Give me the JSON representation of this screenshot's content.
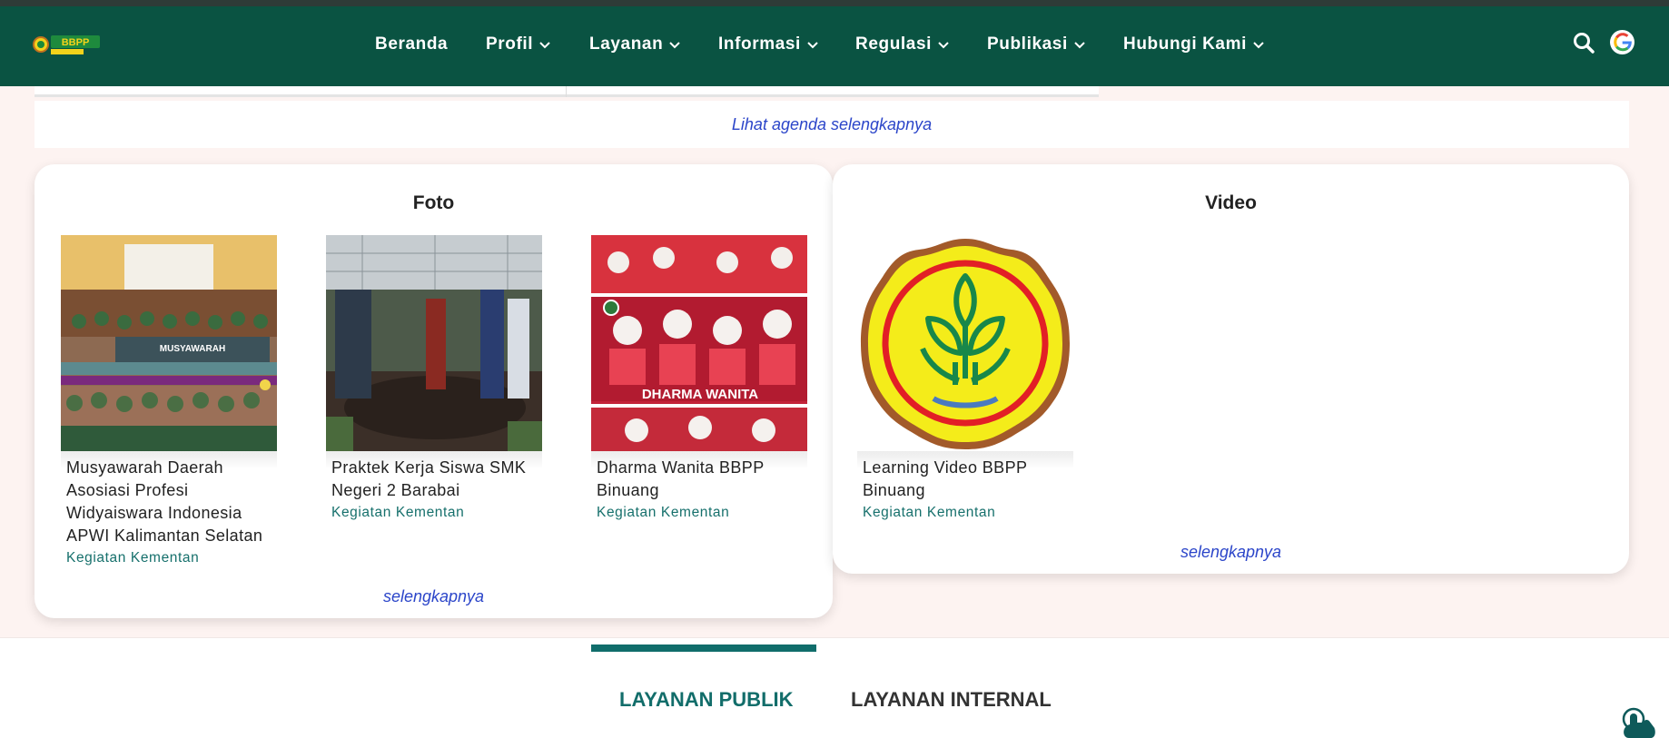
{
  "navbar": {
    "logo_icon": "bbpp-binuang-logo",
    "items": [
      {
        "label": "Beranda",
        "dropdown": false
      },
      {
        "label": "Profil",
        "dropdown": true
      },
      {
        "label": "Layanan",
        "dropdown": true
      },
      {
        "label": "Informasi",
        "dropdown": true
      },
      {
        "label": "Regulasi",
        "dropdown": true
      },
      {
        "label": "Publikasi",
        "dropdown": true
      },
      {
        "label": "Hubungi Kami",
        "dropdown": true
      }
    ],
    "search_icon": "search-icon",
    "translate_icon": "google-icon"
  },
  "agenda": {
    "more_label": "Lihat agenda selengkapnya"
  },
  "foto": {
    "title": "Foto",
    "items": [
      {
        "caption": "Musyawarah Daerah Asosiasi Profesi Widyaiswara Indonesia APWI Kalimantan Selatan",
        "category": "Kegiatan Kementan",
        "image_text": "MUSYAWARAH"
      },
      {
        "caption": "Praktek Kerja Siswa SMK Negeri 2 Barabai",
        "category": "Kegiatan Kementan"
      },
      {
        "caption": "Dharma Wanita BBPP Binuang",
        "category": "Kegiatan Kementan",
        "image_text": "DHARMA WANITA"
      }
    ],
    "more_label": "selengkapnya"
  },
  "video": {
    "title": "Video",
    "items": [
      {
        "caption": "Learning Video BBPP Binuang",
        "category": "Kegiatan Kementan"
      }
    ],
    "more_label": "selengkapnya"
  },
  "services": {
    "tabs": [
      {
        "label": "LAYANAN PUBLIK",
        "active": true
      },
      {
        "label": "LAYANAN INTERNAL",
        "active": false
      }
    ]
  },
  "colors": {
    "navbar": "#0a5342",
    "accent_teal": "#106d6b",
    "link_blue": "#2b45c9",
    "page_background": "#fdf3f1"
  }
}
